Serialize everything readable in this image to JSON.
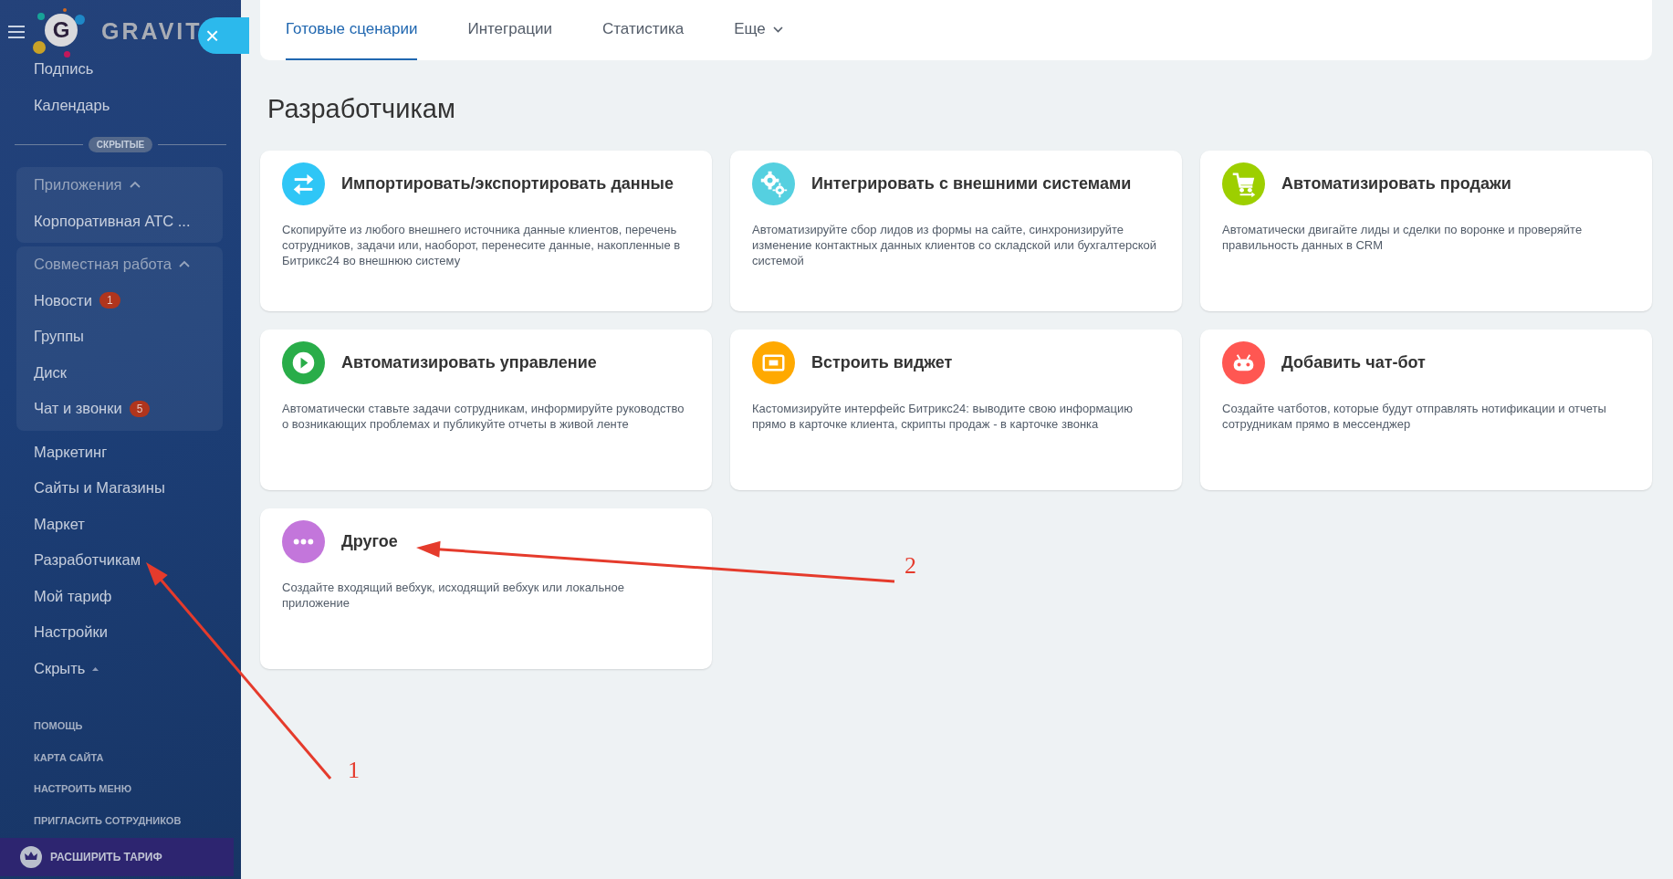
{
  "sidebar": {
    "logo_mark": "G",
    "logo_text": "GRAVIT",
    "close_button": "×",
    "top_items": [
      {
        "label": "Подпись"
      },
      {
        "label": "Календарь"
      }
    ],
    "hidden_divider": "СКРЫТЫЕ",
    "groups": [
      {
        "title": "Приложения",
        "expanded": true,
        "items": [
          {
            "label": "Корпоративная АТС ..."
          }
        ]
      },
      {
        "title": "Совместная работа",
        "expanded": true,
        "items": [
          {
            "label": "Новости",
            "counter": "1"
          },
          {
            "label": "Группы"
          },
          {
            "label": "Диск"
          },
          {
            "label": "Чат и звонки",
            "counter": "5"
          }
        ]
      }
    ],
    "items": [
      {
        "label": "Маркетинг"
      },
      {
        "label": "Сайты и Магазины"
      },
      {
        "label": "Маркет"
      },
      {
        "label": "Разработчикам"
      },
      {
        "label": "Мой тариф"
      },
      {
        "label": "Настройки"
      }
    ],
    "hide_toggle": "Скрыть",
    "links": [
      "ПОМОЩЬ",
      "КАРТА САЙТА",
      "НАСТРОИТЬ МЕНЮ",
      "ПРИГЛАСИТЬ СОТРУДНИКОВ"
    ],
    "upgrade_button": "РАСШИРИТЬ ТАРИФ"
  },
  "tabs": [
    {
      "label": "Готовые сценарии",
      "selected": true,
      "dropdown": false
    },
    {
      "label": "Интеграции",
      "selected": false,
      "dropdown": false
    },
    {
      "label": "Статистика",
      "selected": false,
      "dropdown": false
    },
    {
      "label": "Еще",
      "selected": false,
      "dropdown": true
    }
  ],
  "heading": "Разработчикам",
  "cards": [
    {
      "kind": "transfer",
      "color": "#2fc6f6",
      "title": "Импортировать/экспортировать данные",
      "description": "Скопируйте из любого внешнего источника данные клиентов, перечень сотрудников, задачи или, наоборот, перенесите данные, накопленные в Битрикс24 во внешнюю систему"
    },
    {
      "kind": "gears",
      "color": "#55d0e0",
      "title": "Интегрировать с внешними системами",
      "description": "Автоматизируйте сбор лидов из формы на сайте, синхронизируйте изменение контактных данных клиентов со складской или бухгалтерской системой"
    },
    {
      "kind": "cart",
      "color": "#9dcf00",
      "title": "Автоматизировать продажи",
      "description": "Автоматически двигайте лиды и сделки по воронке и проверяйте правильность данных в CRM"
    },
    {
      "kind": "play",
      "color": "#29ad49",
      "title": "Автоматизировать управление",
      "description": "Автоматически ставьте задачи сотрудникам, информируйте руководство о возникающих проблемах и публикуйте отчеты в живой ленте"
    },
    {
      "kind": "widget",
      "color": "#ffa900",
      "title": "Встроить виджет",
      "description": "Кастомизируйте интерфейс Битрикс24: выводите свою информацию прямо в карточке клиента, скрипты продаж - в карточке звонка"
    },
    {
      "kind": "bot",
      "color": "#ff5752",
      "title": "Добавить чат-бот",
      "description": "Создайте чатботов, которые будут отправлять нотификации и отчеты сотрудникам прямо в мессенджер"
    },
    {
      "kind": "dots",
      "color": "#c376db",
      "title": "Другое",
      "description": "Создайте входящий вебхук, исходящий вебхук или локальное приложение"
    }
  ],
  "annotations": [
    {
      "label": "1"
    },
    {
      "label": "2"
    }
  ]
}
